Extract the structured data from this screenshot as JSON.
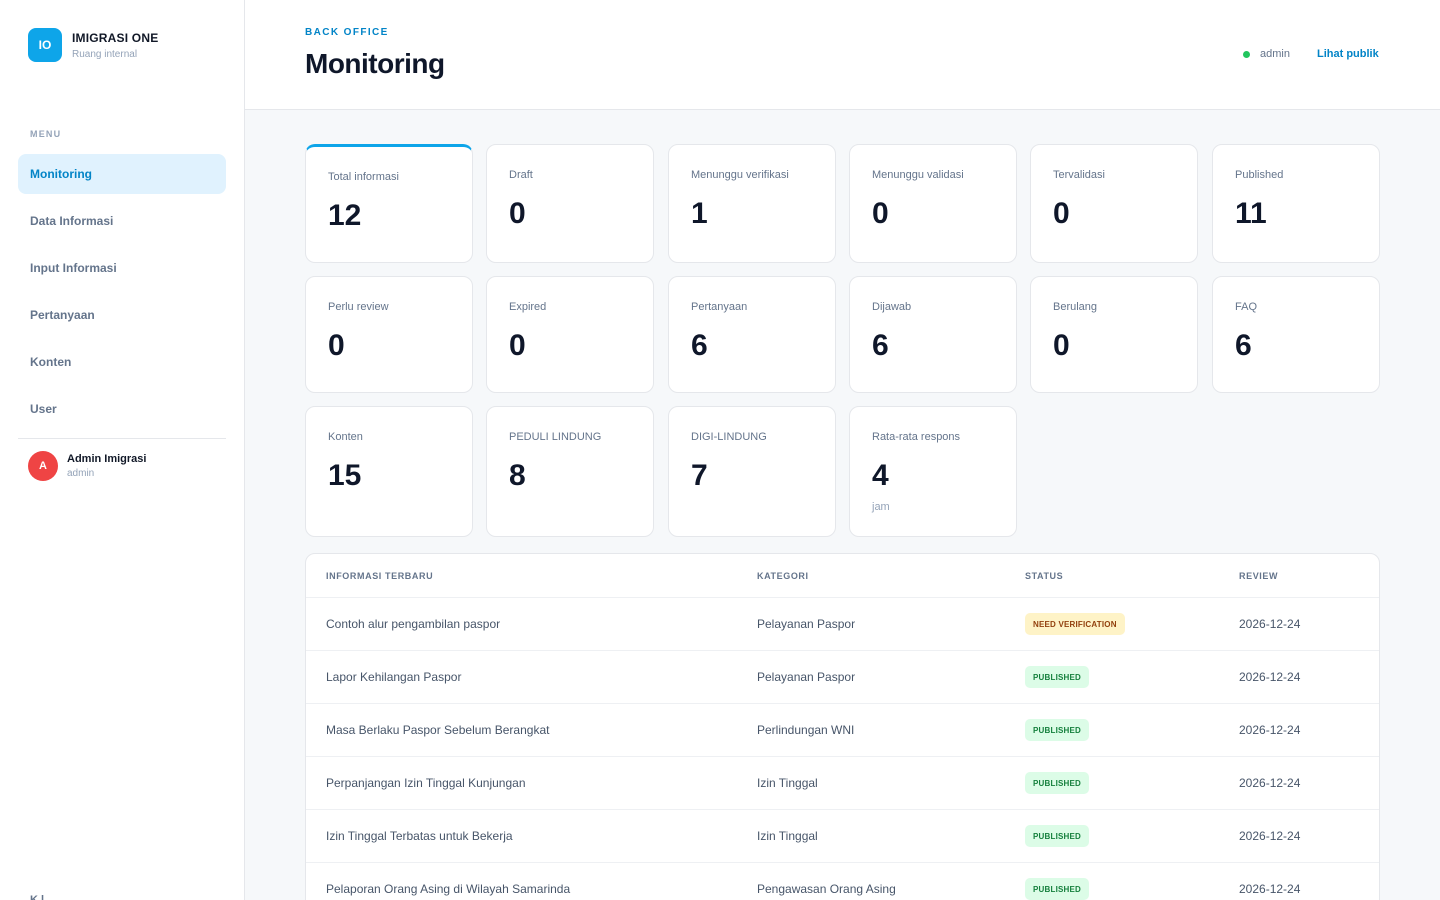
{
  "brand": {
    "logo": "IO",
    "name": "IMIGRASI ONE",
    "subtitle": "Ruang internal"
  },
  "sidebar": {
    "menu_label": "MENU",
    "items": [
      {
        "label": "Monitoring",
        "active": true
      },
      {
        "label": "Data Informasi",
        "active": false
      },
      {
        "label": "Input Informasi",
        "active": false
      },
      {
        "label": "Pertanyaan",
        "active": false
      },
      {
        "label": "Konten",
        "active": false
      },
      {
        "label": "User",
        "active": false
      }
    ],
    "profile": {
      "initial": "A",
      "name": "Admin Imigrasi",
      "role": "admin"
    },
    "bottom_text": "K l"
  },
  "header": {
    "eyebrow": "BACK OFFICE",
    "title": "Monitoring",
    "user": "admin",
    "public_link": "Lihat publik",
    "status_color": "#22c55e"
  },
  "stats": [
    {
      "label": "Total informasi",
      "value": "12"
    },
    {
      "label": "Draft",
      "value": "0"
    },
    {
      "label": "Menunggu verifikasi",
      "value": "1"
    },
    {
      "label": "Menunggu validasi",
      "value": "0"
    },
    {
      "label": "Tervalidasi",
      "value": "0"
    },
    {
      "label": "Published",
      "value": "11"
    },
    {
      "label": "Perlu review",
      "value": "0"
    },
    {
      "label": "Expired",
      "value": "0"
    },
    {
      "label": "Pertanyaan",
      "value": "6"
    },
    {
      "label": "Dijawab",
      "value": "6"
    },
    {
      "label": "Berulang",
      "value": "0"
    },
    {
      "label": "FAQ",
      "value": "6"
    },
    {
      "label": "Konten",
      "value": "15"
    },
    {
      "label": "PEDULI LINDUNG",
      "value": "8"
    },
    {
      "label": "DIGI-LINDUNG",
      "value": "7"
    },
    {
      "label": "Rata-rata respons",
      "value": "4",
      "unit": "jam"
    }
  ],
  "table": {
    "headers": [
      "INFORMASI TERBARU",
      "KATEGORI",
      "STATUS",
      "REVIEW"
    ],
    "rows": [
      {
        "title": "Contoh alur pengambilan paspor",
        "category": "Pelayanan Paspor",
        "status": "NEED VERIFICATION",
        "review": "2026-12-24"
      },
      {
        "title": "Lapor Kehilangan Paspor",
        "category": "Pelayanan Paspor",
        "status": "PUBLISHED",
        "review": "2026-12-24"
      },
      {
        "title": "Masa Berlaku Paspor Sebelum Berangkat",
        "category": "Perlindungan WNI",
        "status": "PUBLISHED",
        "review": "2026-12-24"
      },
      {
        "title": "Perpanjangan Izin Tinggal Kunjungan",
        "category": "Izin Tinggal",
        "status": "PUBLISHED",
        "review": "2026-12-24"
      },
      {
        "title": "Izin Tinggal Terbatas untuk Bekerja",
        "category": "Izin Tinggal",
        "status": "PUBLISHED",
        "review": "2026-12-24"
      },
      {
        "title": "Pelaporan Orang Asing di Wilayah Samarinda",
        "category": "Pengawasan Orang Asing",
        "status": "PUBLISHED",
        "review": "2026-12-24"
      }
    ]
  },
  "colors": {
    "accent": "#0284c7",
    "published_bg": "#dcfce7",
    "verification_bg": "#fef3c7"
  }
}
